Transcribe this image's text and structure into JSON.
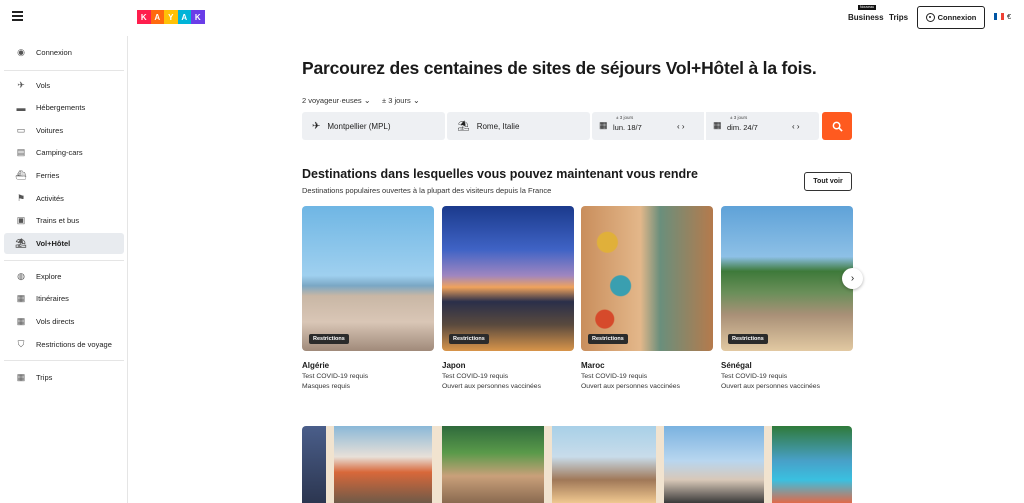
{
  "brand": {
    "letters": [
      "K",
      "A",
      "Y",
      "A",
      "K"
    ],
    "colors": [
      "#ff1e4d",
      "#ff690f",
      "#ffc107",
      "#00b4d8",
      "#6a3de8"
    ]
  },
  "header": {
    "business_badge": "Nouveau",
    "business_label": "Business",
    "trips_label": "Trips",
    "connexion_label": "Connexion",
    "currency": "€"
  },
  "sidebar": {
    "items": [
      {
        "label": "Connexion",
        "icon": "user-icon"
      },
      {
        "label": "Vols",
        "icon": "plane-icon"
      },
      {
        "label": "Hébergements",
        "icon": "bed-icon"
      },
      {
        "label": "Voitures",
        "icon": "car-icon"
      },
      {
        "label": "Camping-cars",
        "icon": "rv-icon"
      },
      {
        "label": "Ferries",
        "icon": "ferry-icon"
      },
      {
        "label": "Activités",
        "icon": "activity-icon"
      },
      {
        "label": "Trains et bus",
        "icon": "train-icon"
      },
      {
        "label": "Vol+Hôtel",
        "icon": "beach-icon",
        "active": true
      },
      {
        "label": "Explore",
        "icon": "globe-icon"
      },
      {
        "label": "Itinéraires",
        "icon": "itinerary-icon"
      },
      {
        "label": "Vols directs",
        "icon": "direct-flight-icon"
      },
      {
        "label": "Restrictions de voyage",
        "icon": "shield-icon"
      },
      {
        "label": "Trips",
        "icon": "trips-icon"
      }
    ]
  },
  "search": {
    "headline": "Parcourez des centaines de sites de séjours Vol+Hôtel à la fois.",
    "travelers": "2 voyageur·euses",
    "flex": "± 3 jours",
    "origin": "Montpellier (MPL)",
    "destination": "Rome, Italie",
    "depart_flex": "± 3 jours",
    "depart_date": "lun. 18/7",
    "return_flex": "± 3 jours",
    "return_date": "dim. 24/7",
    "button_color": "#ff5a1f"
  },
  "destinations": {
    "title": "Destinations dans lesquelles vous pouvez maintenant vous rendre",
    "subtitle": "Destinations populaires ouvertes à la plupart des visiteurs depuis la France",
    "see_all": "Tout voir",
    "cards": [
      {
        "name": "Algérie",
        "badge": "Restrictions",
        "line1": "Test COVID-19 requis",
        "line2": "Masques requis"
      },
      {
        "name": "Japon",
        "badge": "Restrictions",
        "line1": "Test COVID-19 requis",
        "line2": "Ouvert aux personnes vaccinées"
      },
      {
        "name": "Maroc",
        "badge": "Restrictions",
        "line1": "Test COVID-19 requis",
        "line2": "Ouvert aux personnes vaccinées"
      },
      {
        "name": "Sénégal",
        "badge": "Restrictions",
        "line1": "Test COVID-19 requis",
        "line2": "Ouvert aux personnes vaccinées"
      }
    ]
  }
}
